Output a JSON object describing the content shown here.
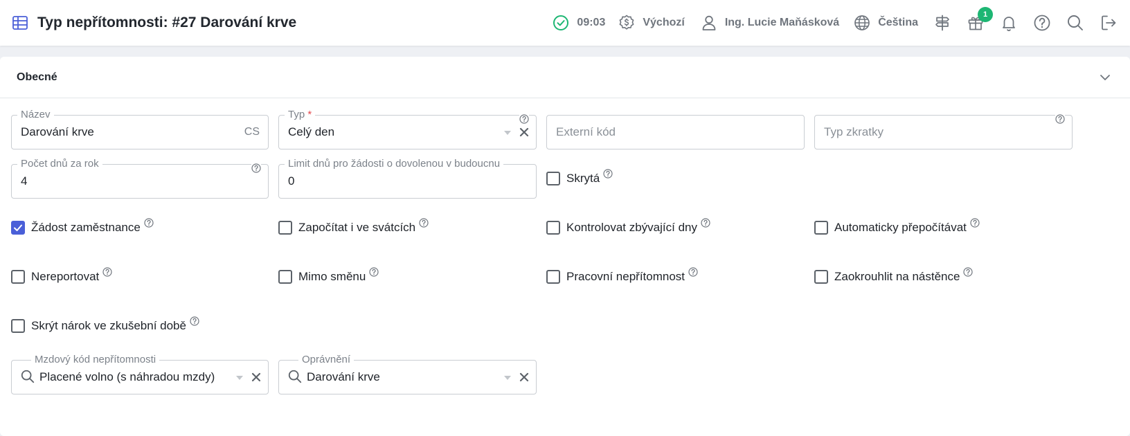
{
  "header": {
    "title": "Typ nepřítomnosti: #27 Darování krve",
    "time": "09:03",
    "currency_profile": "Výchozí",
    "user": "Ing. Lucie Maňásková",
    "language": "Čeština",
    "gift_badge": "1",
    "status_color": "#1db673"
  },
  "section": {
    "title": "Obecné"
  },
  "fields": {
    "nazev": {
      "label": "Název",
      "value": "Darování krve",
      "suffix": "CS"
    },
    "typ": {
      "label": "Typ",
      "required_mark": "*",
      "value": "Celý den"
    },
    "externi_kod": {
      "placeholder": "Externí kód"
    },
    "typ_zkratky": {
      "placeholder": "Typ zkratky"
    },
    "pocet_dnu": {
      "label": "Počet dnů za rok",
      "value": "4"
    },
    "limit_dnu": {
      "label": "Limit dnů pro žádosti o dovolenou v budoucnu",
      "value": "0"
    },
    "mzdovy_kod": {
      "label": "Mzdový kód nepřítomnosti",
      "value": "Placené volno (s náhradou mzdy)"
    },
    "opravneni": {
      "label": "Oprávnění",
      "value": "Darování krve"
    }
  },
  "checkboxes": {
    "skryta": {
      "label": "Skrytá",
      "checked": false
    },
    "zadost": {
      "label": "Žádost zaměstnance",
      "checked": true
    },
    "zapocitat": {
      "label": "Započítat i ve svátcích",
      "checked": false
    },
    "kontrolovat": {
      "label": "Kontrolovat zbývající dny",
      "checked": false
    },
    "automaticky": {
      "label": "Automaticky přepočítávat",
      "checked": false
    },
    "nereportovat": {
      "label": "Nereportovat",
      "checked": false
    },
    "mimo_smenu": {
      "label": "Mimo směnu",
      "checked": false
    },
    "pracovni": {
      "label": "Pracovní nepřítomnost",
      "checked": false
    },
    "zaokrouhlit": {
      "label": "Zaokrouhlit na nástěnce",
      "checked": false
    },
    "skryt_narok": {
      "label": "Skrýt nárok ve zkušební době",
      "checked": false
    }
  },
  "colors": {
    "accent": "#4a5fd8",
    "text": "#1f2329",
    "muted": "#7c828a"
  }
}
